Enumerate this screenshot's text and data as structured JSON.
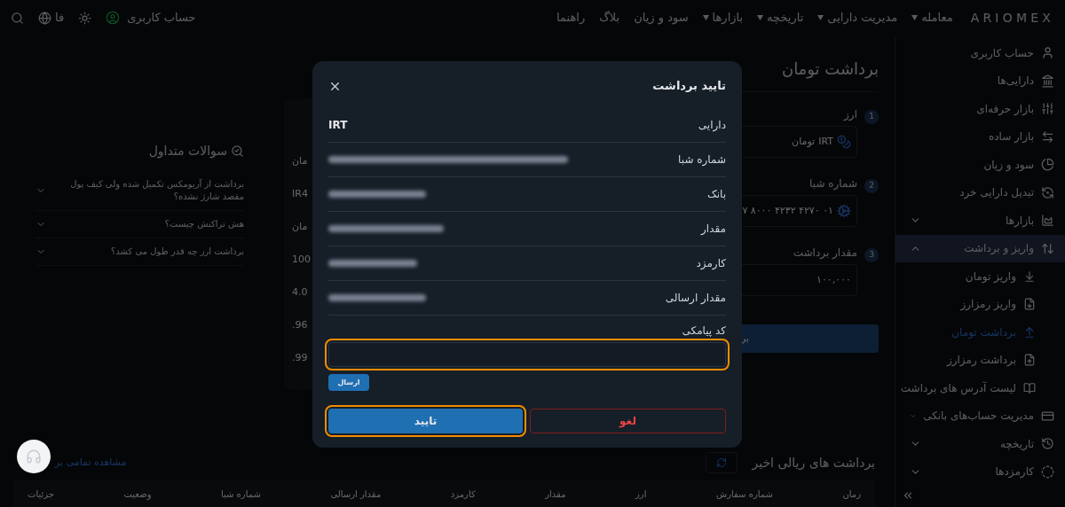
{
  "header": {
    "logo": "ARIOMEX",
    "nav": [
      {
        "label": "معامله",
        "dropdown": true
      },
      {
        "label": "مدیریت دارایی",
        "dropdown": true
      },
      {
        "label": "تاریخچه",
        "dropdown": true
      },
      {
        "label": "بازارها",
        "dropdown": true
      },
      {
        "label": "سود و زیان",
        "dropdown": false
      },
      {
        "label": "بلاگ",
        "dropdown": false
      },
      {
        "label": "راهنما",
        "dropdown": false
      }
    ],
    "account": "حساب کاربری",
    "language": "فا"
  },
  "sidebar": {
    "items": [
      {
        "label": "حساب کاربری",
        "selected": false
      },
      {
        "label": "دارایی‌ها",
        "selected": false
      },
      {
        "label": "بازار حرفه‌ای",
        "selected": false
      },
      {
        "label": "بازار ساده",
        "selected": false
      },
      {
        "label": "سود و زیان",
        "selected": false
      },
      {
        "label": "تبدیل دارایی خرد",
        "selected": false
      },
      {
        "label": "بازارها",
        "selected": false,
        "expanded": false
      },
      {
        "label": "واریز و برداشت",
        "selected": true,
        "expanded": true,
        "children": [
          {
            "label": "واریز تومان",
            "selected": false
          },
          {
            "label": "واریز رمزارز",
            "selected": false
          },
          {
            "label": "برداشت تومان",
            "selected": true
          },
          {
            "label": "برداشت رمزارز",
            "selected": false
          },
          {
            "label": "لیست آدرس های برداشت",
            "selected": false
          }
        ]
      },
      {
        "label": "مدیریت حساب‌های بانکی",
        "selected": false,
        "expanded": false
      },
      {
        "label": "تاریخچه",
        "selected": false,
        "expanded": false
      },
      {
        "label": "کارمزدها",
        "selected": false,
        "expanded": false
      }
    ]
  },
  "page": {
    "title": "برداشت تومان",
    "steps": [
      {
        "number": "1",
        "label": "ارز",
        "value": "IRT",
        "unit": "تومان"
      },
      {
        "number": "2",
        "label": "شماره شبا",
        "value": "۷ ۸۰۰۰ ۴۲۳۲ ۴۲۷۰ ۰۱"
      },
      {
        "number": "3",
        "label": "مقدار برداشت",
        "value": "۱۰۰,۰۰۰"
      }
    ],
    "submit": "بر",
    "summary_values": [
      "مان",
      "IR4",
      "مان",
      "100",
      "4.0",
      "96.",
      "99."
    ],
    "faq": {
      "title": "سوالات متداول",
      "questions": [
        {
          "text": "برداشت از آریومکس تکمیل شده ولی کیف پول مقصد شارژ نشده؟",
          "expanded": false
        },
        {
          "text": "هش تراکنش چیست؟",
          "expanded": false
        },
        {
          "text": "برداشت ارز چه قدر طول می کشد؟",
          "expanded": false
        }
      ]
    },
    "recent": {
      "title": "برداشت های ریالی اخیر",
      "link": "مشاهده تمامی بر",
      "columns": [
        "زمان",
        "شماره سفارش",
        "ارز",
        "مقدار",
        "کارمزد",
        "مقدار ارسالی",
        "شماره شبا",
        "وضعیت",
        "جزئیات"
      ]
    }
  },
  "modal": {
    "title": "تایید برداشت",
    "rows": [
      {
        "label": "دارایی",
        "value": "IRT",
        "blurred": false
      },
      {
        "label": "شماره شبا",
        "blurred": true
      },
      {
        "label": "بانک",
        "blurred": true
      },
      {
        "label": "مقدار",
        "blurred": true
      },
      {
        "label": "کارمزد",
        "blurred": true
      },
      {
        "label": "مقدار ارسالی",
        "blurred": true
      }
    ],
    "code_label": "کد پیامکی",
    "code_field": {
      "highlighted": true
    },
    "send": "ارسال",
    "confirm": {
      "label": "تایید",
      "highlighted": true
    },
    "cancel": "لغو"
  }
}
